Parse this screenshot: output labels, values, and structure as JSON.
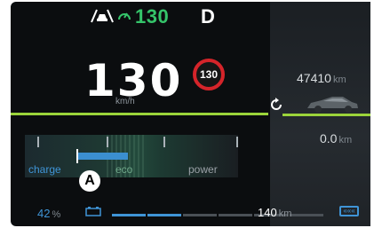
{
  "top_bar": {
    "acc_icon": "adaptive-cruise-icon",
    "cruise_speed": "130",
    "gear": "D"
  },
  "speedometer": {
    "speed": "130",
    "unit": "km/h",
    "speed_limit": "130"
  },
  "right_panel": {
    "odometer_value": "47410",
    "odometer_unit": "km",
    "trip_value": "0.0",
    "trip_unit": "km",
    "reset_icon": "trip-reset-icon",
    "car_icon": "car-silhouette-icon"
  },
  "power_meter": {
    "labels": {
      "charge": "charge",
      "eco": "eco",
      "power": "power"
    },
    "needle_level_percent": 25
  },
  "marker": {
    "label": "A"
  },
  "bottom_bar": {
    "battery_percent_value": "42",
    "battery_percent_unit": "%",
    "battery_icon": "battery-icon",
    "range_value": "140",
    "range_unit": "km",
    "charging_icon": "charging-connection-icon",
    "gauge_segments_filled": 2,
    "gauge_segments_total": 6
  },
  "colors": {
    "background": "#0b0d0f",
    "cruise_green": "#35c46a",
    "limit_red": "#d5242a",
    "accent_blue": "#3f94d6",
    "line_green": "#9bd43a"
  }
}
